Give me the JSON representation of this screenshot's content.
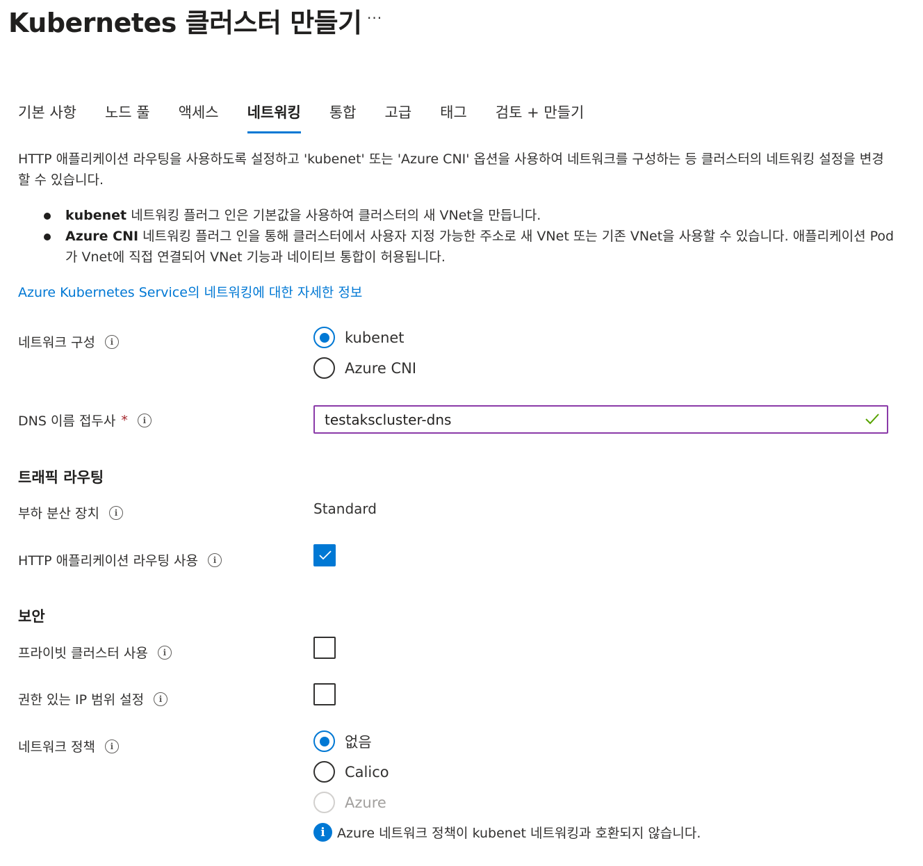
{
  "page": {
    "title": "Kubernetes 클러스터 만들기",
    "more_label": "···"
  },
  "tabs": [
    {
      "label": "기본 사항",
      "active": false
    },
    {
      "label": "노드 풀",
      "active": false
    },
    {
      "label": "액세스",
      "active": false
    },
    {
      "label": "네트워킹",
      "active": true
    },
    {
      "label": "통합",
      "active": false
    },
    {
      "label": "고급",
      "active": false
    },
    {
      "label": "태그",
      "active": false
    },
    {
      "label": "검토 + 만들기",
      "active": false
    }
  ],
  "intro": {
    "description": "HTTP 애플리케이션 라우팅을 사용하도록 설정하고 'kubenet' 또는 'Azure CNI' 옵션을 사용하여 네트워크를 구성하는 등 클러스터의 네트워킹 설정을 변경할 수 있습니다.",
    "bullets": [
      {
        "term": "kubenet",
        "text": " 네트워킹 플러그 인은 기본값을 사용하여 클러스터의 새 VNet을 만듭니다."
      },
      {
        "term": "Azure CNI",
        "text": " 네트워킹 플러그 인을 통해 클러스터에서 사용자 지정 가능한 주소로 새 VNet 또는 기존 VNet을 사용할 수 있습니다. 애플리케이션 Pod가 Vnet에 직접 연결되어 VNet 기능과 네이티브 통합이 허용됩니다."
      }
    ],
    "learn_more_link": "Azure Kubernetes Service의 네트워킹에 대한 자세한 정보"
  },
  "network_config": {
    "label": "네트워크 구성",
    "options": [
      {
        "label": "kubenet",
        "selected": true
      },
      {
        "label": "Azure CNI",
        "selected": false
      }
    ]
  },
  "dns_prefix": {
    "label": "DNS 이름 접두사",
    "required_marker": "*",
    "value": "testakscluster-dns",
    "valid": true
  },
  "traffic_routing": {
    "heading": "트래픽 라우팅",
    "load_balancer_label": "부하 분산 장치",
    "load_balancer_value": "Standard",
    "http_routing_label": "HTTP 애플리케이션 라우팅 사용",
    "http_routing_checked": true
  },
  "security": {
    "heading": "보안",
    "private_cluster_label": "프라이빗 클러스터 사용",
    "private_cluster_checked": false,
    "authorized_ip_label": "권한 있는 IP 범위 설정",
    "authorized_ip_checked": false,
    "network_policy_label": "네트워크 정책",
    "network_policy_options": [
      {
        "label": "없음",
        "selected": true,
        "disabled": false
      },
      {
        "label": "Calico",
        "selected": false,
        "disabled": false
      },
      {
        "label": "Azure",
        "selected": false,
        "disabled": true
      }
    ],
    "notice": "Azure 네트워크 정책이 kubenet 네트워킹과 호환되지 않습니다."
  },
  "icons": {
    "info": "info-icon",
    "valid": "checkmark-icon",
    "notice": "info-filled-icon"
  },
  "colors": {
    "accent": "#0078d4",
    "input_focus_border": "#8a3aa8",
    "valid_check": "#57a300",
    "required": "#a4262c",
    "disabled": "#a19f9d"
  }
}
